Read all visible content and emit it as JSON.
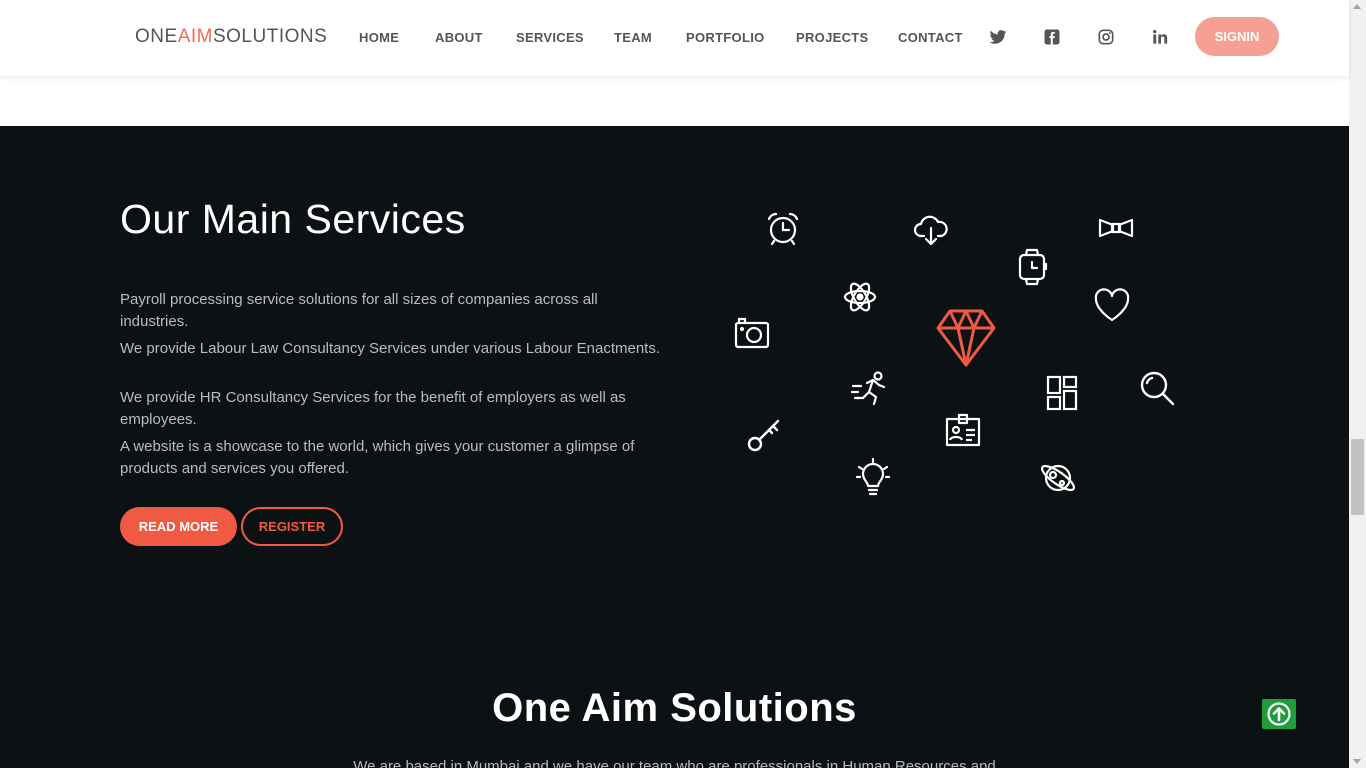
{
  "header": {
    "logo": {
      "part1": "ONE",
      "part2": "AIM",
      "part3": "SOLUTIONS"
    },
    "nav": [
      {
        "label": "HOME"
      },
      {
        "label": "ABOUT"
      },
      {
        "label": "SERVICES"
      },
      {
        "label": "TEAM"
      },
      {
        "label": "PORTFOLIO"
      },
      {
        "label": "PROJECTS"
      },
      {
        "label": "CONTACT"
      }
    ],
    "social_icons": [
      "twitter-icon",
      "facebook-icon",
      "instagram-icon",
      "linkedin-icon"
    ],
    "signin_label": "SIGNIN"
  },
  "services": {
    "title": "Our Main Services",
    "paragraphs": [
      "Payroll processing service solutions for all sizes of companies across all industries.",
      "We provide Labour Law Consultancy Services under various Labour Enactments.",
      "We provide HR Consultancy Services for the benefit of employers as well as employees.",
      "A website is a showcase to the world, which gives your customer a glimpse of products and services you offered."
    ],
    "read_more_label": "READ MORE",
    "register_label": "REGISTER",
    "icons": [
      "alarm-clock-icon",
      "cloud-download-icon",
      "bow-tie-icon",
      "smartwatch-icon",
      "atom-icon",
      "heart-icon",
      "camera-icon",
      "diamond-icon",
      "runner-icon",
      "dashboard-icon",
      "search-icon",
      "key-icon",
      "id-card-icon",
      "lightbulb-icon",
      "planet-icon"
    ]
  },
  "about": {
    "title": "One Aim Solutions",
    "text": "We are based in Mumbai and we have our team who are professionals in Human Resources and"
  },
  "colors": {
    "accent": "#f05a43",
    "signin": "#f5a093",
    "dark_bg": "#0c1113",
    "back_to_top": "#1f9d3a"
  }
}
